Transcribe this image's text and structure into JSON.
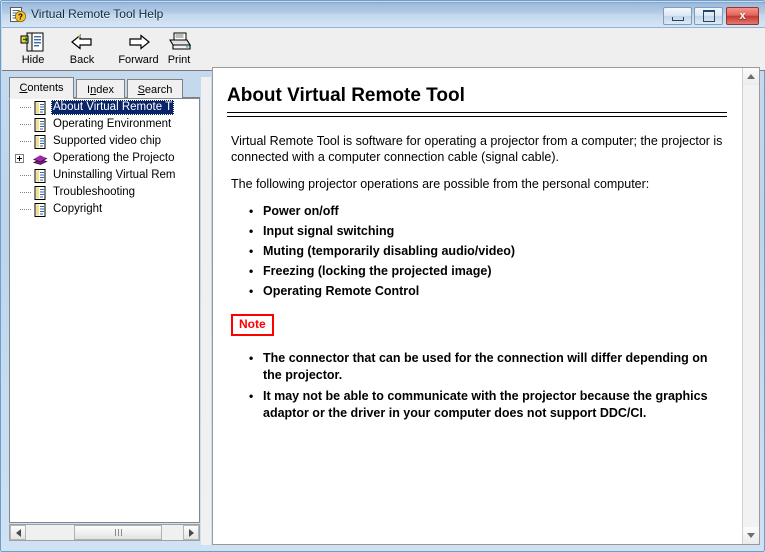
{
  "window": {
    "title": "Virtual Remote Tool Help",
    "icon": "help-document-icon",
    "controls": {
      "minimize": "–",
      "maximize": "□",
      "close": "x"
    }
  },
  "toolbar": {
    "buttons": [
      {
        "label": "Hide",
        "icon": "hide-pane-icon"
      },
      {
        "label": "Back",
        "icon": "back-arrow-icon"
      },
      {
        "label": "Forward",
        "icon": "forward-arrow-icon"
      },
      {
        "label": "Print",
        "icon": "printer-icon"
      }
    ]
  },
  "nav": {
    "tabs": [
      {
        "label": "Contents",
        "accel": "C",
        "active": true
      },
      {
        "label": "Index",
        "accel": "I",
        "active": false
      },
      {
        "label": "Search",
        "accel": "S",
        "active": false
      }
    ],
    "tree": [
      {
        "label": "About Virtual Remote T",
        "icon": "page-icon",
        "selected": true,
        "expandable": false
      },
      {
        "label": "Operating Environment",
        "icon": "page-icon",
        "selected": false,
        "expandable": false
      },
      {
        "label": "Supported video chip",
        "icon": "page-icon",
        "selected": false,
        "expandable": false
      },
      {
        "label": "Operationg the Projecto",
        "icon": "book-icon",
        "selected": false,
        "expandable": true
      },
      {
        "label": "Uninstalling Virtual Rem",
        "icon": "page-icon",
        "selected": false,
        "expandable": false
      },
      {
        "label": "Troubleshooting",
        "icon": "page-icon",
        "selected": false,
        "expandable": false
      },
      {
        "label": "Copyright",
        "icon": "page-icon",
        "selected": false,
        "expandable": false
      }
    ],
    "hscrollbar": {
      "left_arrow": "scroll-left-icon",
      "right_arrow": "scroll-right-icon"
    }
  },
  "content": {
    "title": "About Virtual Remote Tool",
    "paragraphs": [
      "Virtual Remote Tool is software for operating a projector from a computer; the projector is connected with a computer connection cable (signal cable).",
      "The following projector operations are possible from the personal computer:"
    ],
    "features": [
      "Power on/off",
      "Input signal switching",
      "Muting (temporarily disabling audio/video)",
      "Freezing (locking the projected image)",
      "Operating Remote Control"
    ],
    "note_label": "Note",
    "note_color": "#ff0000",
    "notes": [
      "The connector that can be used for the connection will differ depending on the projector.",
      "It may not be able to communicate with the projector because the graphics adaptor or the driver in your computer does not support DDC/CI."
    ],
    "vscrollbar": {
      "up_arrow": "scroll-up-icon",
      "down_arrow": "scroll-down-icon"
    }
  },
  "colors": {
    "titlebar_top": "#9cbbdc",
    "titlebar_bottom": "#d7e6f5",
    "toolbar_bg": "#efefef",
    "selection": "#0a246a",
    "note_red": "#ff0000",
    "window_border": "#6d9ec9"
  }
}
